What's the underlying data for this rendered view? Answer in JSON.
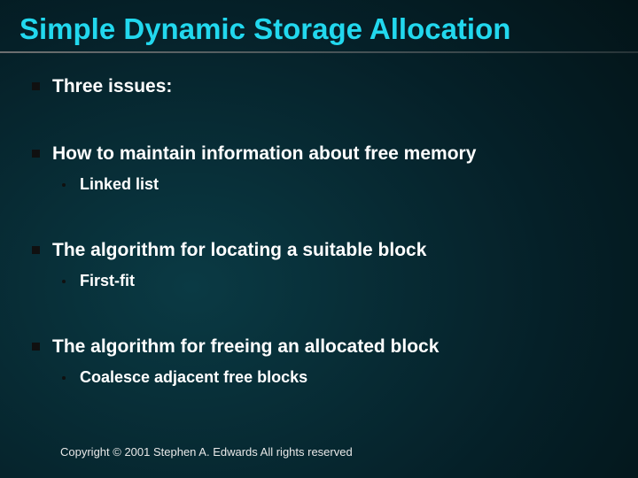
{
  "title": "Simple Dynamic Storage Allocation",
  "bullets": {
    "b1": "Three issues:",
    "b2": "How to maintain information about free memory",
    "b2a": "Linked list",
    "b3": "The algorithm for locating a suitable block",
    "b3a": "First-fit",
    "b4": "The algorithm for freeing an allocated block",
    "b4a": "Coalesce adjacent free blocks"
  },
  "footer": "Copyright © 2001 Stephen A. Edwards  All rights reserved"
}
